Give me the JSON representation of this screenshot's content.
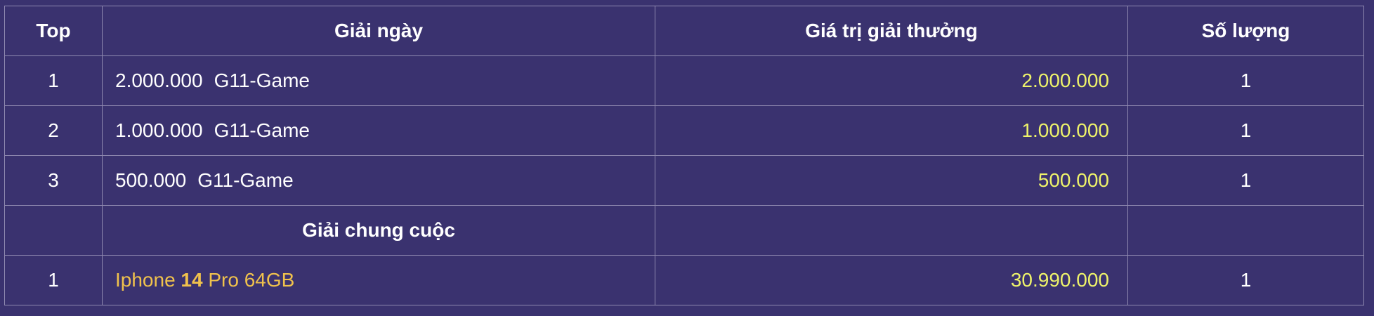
{
  "table": {
    "headers": {
      "top": "Top",
      "daily": "Giải ngày",
      "value": "Giá trị giải thưởng",
      "qty": "Số lượng"
    },
    "daily_rows": [
      {
        "top": "1",
        "amount": "2.000.000",
        "game": "G11-Game",
        "value": "2.000.000",
        "qty": "1"
      },
      {
        "top": "2",
        "amount": "1.000.000",
        "game": "G11-Game",
        "value": "1.000.000",
        "qty": "1"
      },
      {
        "top": "3",
        "amount": "500.000",
        "game": "G11-Game",
        "value": "500.000",
        "qty": "1"
      }
    ],
    "final_section_title": "Giải chung cuộc",
    "final_rows": [
      {
        "top": "1",
        "prize_pre": "Iphone ",
        "prize_bold": "14",
        "prize_post": " Pro 64GB",
        "value": "30.990.000",
        "qty": "1"
      }
    ]
  },
  "colors": {
    "background": "#3a326f",
    "border": "#8f89b0",
    "value_text": "#eef36a",
    "prize_text": "#f0c24c"
  }
}
